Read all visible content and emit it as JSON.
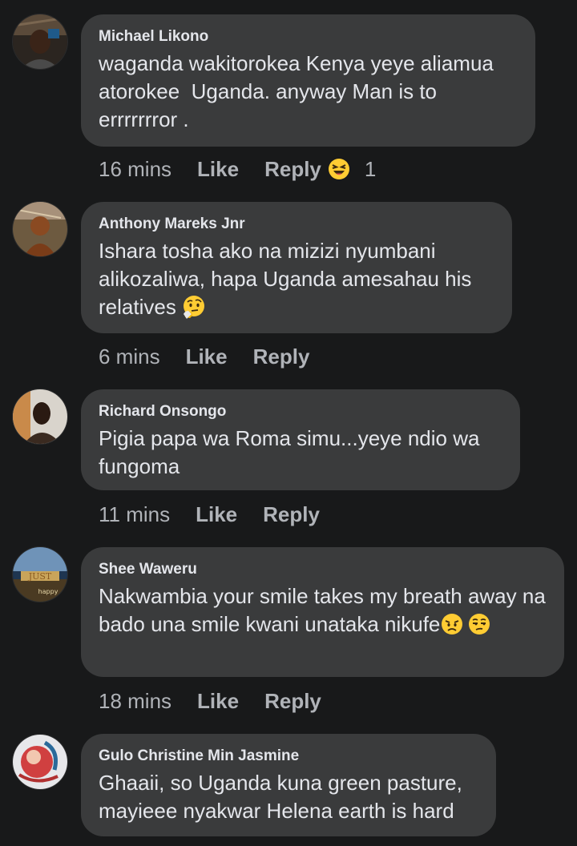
{
  "comments": [
    {
      "author": "Michael Likono",
      "text": "waganda wakitorokea Kenya yeye aliamua atorokee  Uganda. anyway Man is to errrrrrror .",
      "time": "16 mins",
      "like_label": "Like",
      "reply_label": "Reply",
      "reaction_icon": "laughing-squint-face-icon",
      "reaction_count": "1"
    },
    {
      "author": "Anthony Mareks Jnr",
      "text": "Ishara tosha ako na mizizi nyumbani alikozaliwa, hapa Uganda amesahau his relatives",
      "text_emoji": "thinking-face-icon",
      "time": "6 mins",
      "like_label": "Like",
      "reply_label": "Reply"
    },
    {
      "author": "Richard Onsongo",
      "text": "Pigia papa wa Roma simu...yeye ndio wa fungoma",
      "time": "11 mins",
      "like_label": "Like",
      "reply_label": "Reply"
    },
    {
      "author": "Shee Waweru",
      "text": "Nakwambia your smile takes my breath away na bado una smile kwani unataka nikufe",
      "text_emoji": [
        "weary-face-icon",
        "unamused-face-icon"
      ],
      "time": "18 mins",
      "like_label": "Like",
      "reply_label": "Reply"
    },
    {
      "author": "Gulo Christine Min Jasmine",
      "text": "Ghaaii, so Uganda kuna green pasture, mayieee nyakwar Helena earth is hard"
    }
  ],
  "colors": {
    "background": "#18191a",
    "bubble": "#3a3b3c",
    "primary_text": "#e4e6eb",
    "secondary_text": "#b0b3b8",
    "emoji_yellow": "#ffcc33"
  }
}
